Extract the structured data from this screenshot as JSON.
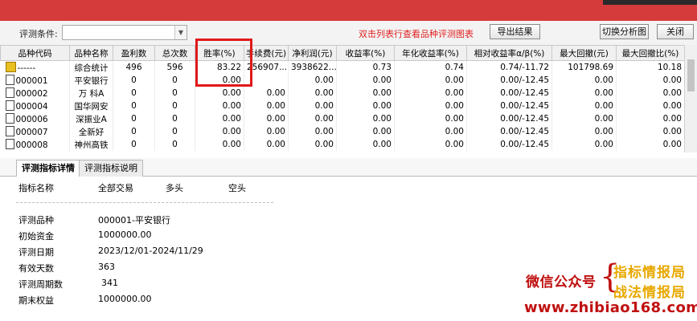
{
  "toolbar": {
    "condition_label": "评测条件:",
    "condition_value": "",
    "hint": "双击列表行查看品种评测图表",
    "export_label": "导出结果",
    "switch_label": "切换分析图",
    "close_label": "关闭"
  },
  "table": {
    "columns": [
      "品种代码",
      "品种名称",
      "盈利数",
      "总次数",
      "胜率(%)",
      "手续费(元)",
      "净利润(元)",
      "收益率(%)",
      "年化收益率(%)",
      "相对收益率α/β(%)",
      "最大回撤(元)",
      "最大回撤比(%)"
    ],
    "rows": [
      {
        "code": "------",
        "name": "综合统计",
        "win": "496",
        "total": "596",
        "rate": "83.22",
        "fee": "256907....",
        "net": "3938622...",
        "ret": "0.73",
        "annual": "0.74",
        "alpha": "0.74/-11.72",
        "maxdd": "101798.69",
        "maxddr": "10.18"
      },
      {
        "code": "000001",
        "name": "平安银行",
        "win": "0",
        "total": "0",
        "rate": "0.00",
        "fee": "",
        "net": "0.00",
        "ret": "0.00",
        "annual": "0.00",
        "alpha": "0.00/-12.45",
        "maxdd": "0.00",
        "maxddr": "0.00"
      },
      {
        "code": "000002",
        "name": "万 科A",
        "win": "0",
        "total": "0",
        "rate": "0.00",
        "fee": "0.00",
        "net": "0.00",
        "ret": "0.00",
        "annual": "0.00",
        "alpha": "0.00/-12.45",
        "maxdd": "0.00",
        "maxddr": "0.00"
      },
      {
        "code": "000004",
        "name": "国华网安",
        "win": "0",
        "total": "0",
        "rate": "0.00",
        "fee": "0.00",
        "net": "0.00",
        "ret": "0.00",
        "annual": "0.00",
        "alpha": "0.00/-12.45",
        "maxdd": "0.00",
        "maxddr": "0.00"
      },
      {
        "code": "000006",
        "name": "深振业A",
        "win": "0",
        "total": "0",
        "rate": "0.00",
        "fee": "0.00",
        "net": "0.00",
        "ret": "0.00",
        "annual": "0.00",
        "alpha": "0.00/-12.45",
        "maxdd": "0.00",
        "maxddr": "0.00"
      },
      {
        "code": "000007",
        "name": "全新好",
        "win": "0",
        "total": "0",
        "rate": "0.00",
        "fee": "0.00",
        "net": "0.00",
        "ret": "0.00",
        "annual": "0.00",
        "alpha": "0.00/-12.45",
        "maxdd": "0.00",
        "maxddr": "0.00"
      },
      {
        "code": "000008",
        "name": "神州高铁",
        "win": "0",
        "total": "0",
        "rate": "0.00",
        "fee": "0.00",
        "net": "0.00",
        "ret": "0.00",
        "annual": "0.00",
        "alpha": "0.00/-12.45",
        "maxdd": "0.00",
        "maxddr": "0.00"
      }
    ]
  },
  "tabs": [
    "评测指标详情",
    "评测指标说明"
  ],
  "detail": {
    "headers": [
      "指标名称",
      "全部交易",
      "多头",
      "空头"
    ],
    "rows": [
      {
        "label": "评测品种",
        "value": "000001-平安银行"
      },
      {
        "label": "初始资金",
        "value": "1000000.00"
      },
      {
        "label": "评测日期",
        "value": "2023/12/01-2024/11/29"
      },
      {
        "label": "有效天数",
        "value": "363"
      },
      {
        "label": "评测周期数",
        "value": "341"
      },
      {
        "label": "期末权益",
        "value": "1000000.00"
      }
    ]
  },
  "watermark": {
    "wechat": "微信公众号",
    "brand1": "指标情报局",
    "brand2": "战法情报局",
    "url": "www.zhibiao168.com"
  }
}
